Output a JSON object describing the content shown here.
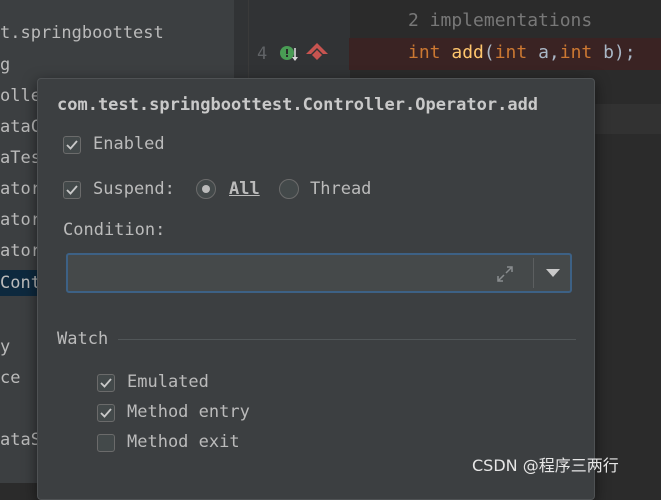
{
  "project_tree": {
    "items": [
      {
        "label": "t.springboottest"
      },
      {
        "label": "g"
      },
      {
        "label": "oller"
      },
      {
        "label": "ataC"
      },
      {
        "label": "aTes"
      },
      {
        "label": "ator"
      },
      {
        "label": "ator"
      },
      {
        "label": "ator"
      },
      {
        "label": "Contr"
      },
      {
        "label": ""
      },
      {
        "label": "y"
      },
      {
        "label": "ce"
      },
      {
        "label": ""
      },
      {
        "label": "ataS"
      }
    ]
  },
  "editor": {
    "line_number": "4",
    "hint": "2 implementations",
    "code": {
      "kw1": "int",
      "fn": "add",
      "p1": "(",
      "kw2": "int",
      "a": " a,",
      "kw3": "int",
      "b": " b);"
    }
  },
  "breakpoint_popup": {
    "title": "com.test.springboottest.Controller.Operator.add",
    "enabled_label": "Enabled",
    "suspend_label": "Suspend:",
    "all_label": "All",
    "thread_label": "Thread",
    "condition_label": "Condition:",
    "condition_value": "",
    "watch_label": "Watch",
    "emulated_label": "Emulated",
    "method_entry_label": "Method entry",
    "method_exit_label": "Method exit"
  },
  "watermark": "CSDN @程序三两行",
  "colors": {
    "accent": "#3d6185",
    "breakpoint": "#c75450"
  }
}
